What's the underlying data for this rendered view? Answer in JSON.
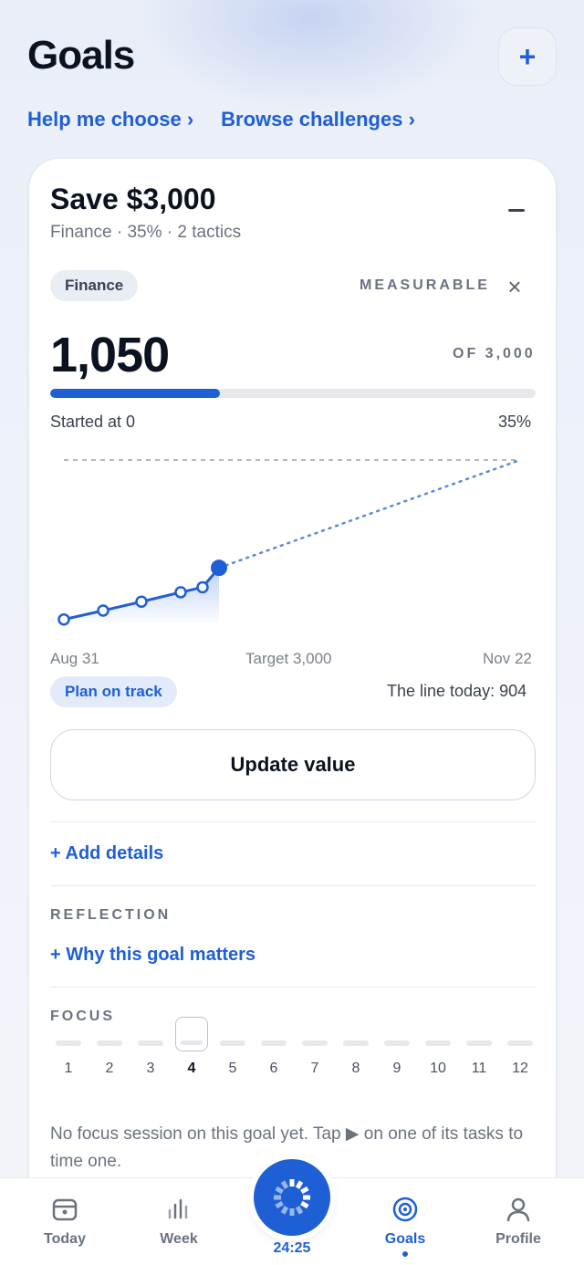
{
  "header": {
    "title": "Goals",
    "add_label": "+"
  },
  "links": {
    "help": "Help me choose ›",
    "browse": "Browse challenges ›"
  },
  "goal": {
    "title": "Save $3,000",
    "subtitle": "Finance · 35% · 2 tactics",
    "category": "Finance",
    "type": "MEASURABLE",
    "current": "1,050",
    "target_label": "OF 3,000",
    "progress_percent": 35,
    "started": "Started at 0",
    "percent_text": "35%",
    "axis": {
      "start": "Aug 31",
      "mid": "Target 3,000",
      "end": "Nov 22"
    },
    "status": "Plan on track",
    "line_today": "The line today: 904",
    "update_button": "Update value",
    "add_details": "+ Add details",
    "reflection_label": "REFLECTION",
    "why_link": "+ Why this goal matters",
    "focus_label": "FOCUS",
    "focus_slots": [
      "1",
      "2",
      "3",
      "4",
      "5",
      "6",
      "7",
      "8",
      "9",
      "10",
      "11",
      "12"
    ],
    "focus_selected": 4,
    "focus_empty": "No focus session on this goal yet. Tap ▶ on one of its tasks to time one."
  },
  "chart_data": {
    "type": "line",
    "series": [
      {
        "values": [
          120,
          280,
          440,
          610,
          700,
          1050
        ]
      }
    ],
    "ylim": [
      0,
      3000
    ]
  },
  "nav": {
    "today": "Today",
    "week": "Week",
    "timer": "24:25",
    "goals": "Goals",
    "profile": "Profile"
  },
  "colors": {
    "accent": "#1f5fd6",
    "muted": "#6b7280",
    "dark": "#0b1220"
  }
}
